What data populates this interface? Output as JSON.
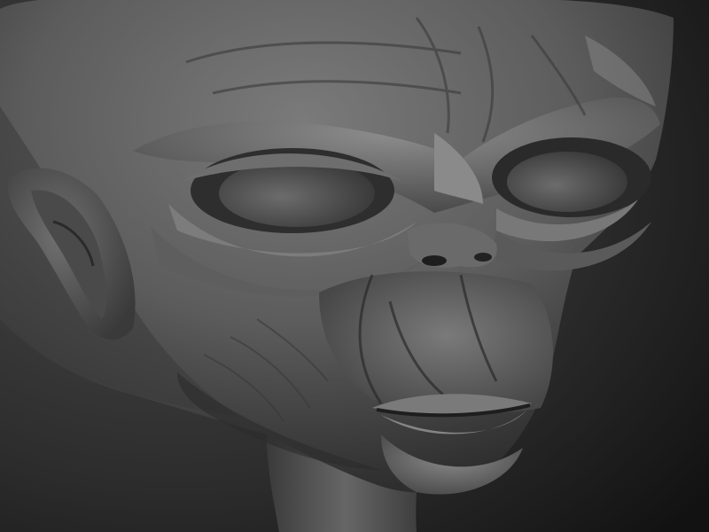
{
  "scene": {
    "subject": "grey-clay-sculpt-head",
    "colors": {
      "background_light": "#4a4a4a",
      "background_dark": "#121212",
      "clay_light": "#8a8a8a",
      "clay_mid": "#5c5c5c",
      "clay_dark": "#2e2e2e",
      "crease": "#1e1e1e"
    }
  }
}
